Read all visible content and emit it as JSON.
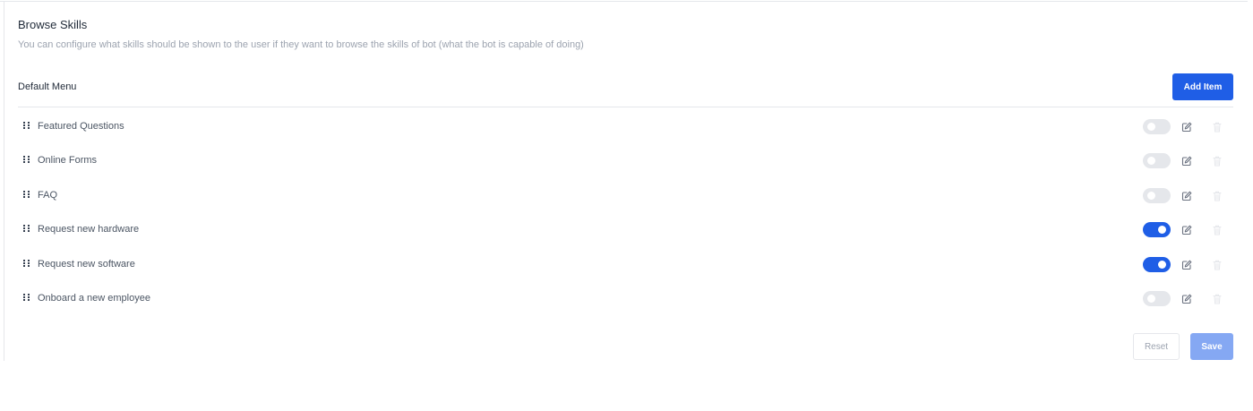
{
  "header": {
    "title": "Browse Skills",
    "subtitle": "You can configure what skills should be shown to the user if they want to browse the skills of bot (what the bot is capable of doing)"
  },
  "section": {
    "title": "Default Menu",
    "add_label": "Add Item"
  },
  "items": [
    {
      "label": "Featured Questions",
      "enabled": false
    },
    {
      "label": "Online Forms",
      "enabled": false
    },
    {
      "label": "FAQ",
      "enabled": false
    },
    {
      "label": "Request new hardware",
      "enabled": true
    },
    {
      "label": "Request new software",
      "enabled": true
    },
    {
      "label": "Onboard a new employee",
      "enabled": false
    }
  ],
  "icons": {
    "drag": "drag-handle-icon",
    "edit": "edit-icon",
    "delete": "trash-icon"
  },
  "footer": {
    "reset_label": "Reset",
    "save_label": "Save"
  },
  "colors": {
    "accent": "#1f5ee6",
    "toggle_off": "#e5e7eb",
    "save_disabled": "#85a8f3"
  }
}
